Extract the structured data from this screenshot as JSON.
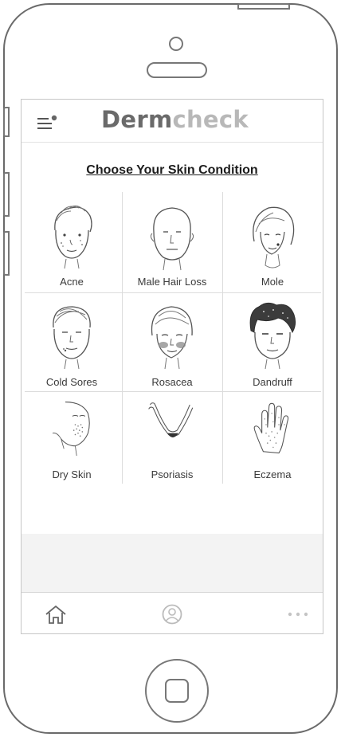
{
  "app": {
    "brand_part1": "Derm",
    "brand_part2": "check"
  },
  "page": {
    "title": "Choose Your Skin Condition"
  },
  "conditions": [
    {
      "label": "Acne",
      "icon": "face-acne-icon"
    },
    {
      "label": "Male Hair Loss",
      "icon": "bald-man-icon"
    },
    {
      "label": "Mole",
      "icon": "woman-mole-icon"
    },
    {
      "label": "Cold Sores",
      "icon": "face-cold-sores-icon"
    },
    {
      "label": "Rosacea",
      "icon": "face-rosacea-icon"
    },
    {
      "label": "Dandruff",
      "icon": "dark-hair-icon"
    },
    {
      "label": "Dry Skin",
      "icon": "dry-skin-face-icon"
    },
    {
      "label": "Psoriasis",
      "icon": "arm-psoriasis-icon"
    },
    {
      "label": "Eczema",
      "icon": "hand-eczema-icon"
    }
  ],
  "tabbar": {
    "items": [
      "home-icon",
      "profile-icon",
      "more-icon"
    ]
  },
  "colors": {
    "line": "#dcdcdc",
    "text": "#3a3a3a",
    "brand_dark": "#6a6a6a",
    "brand_light": "#b8b8b8"
  }
}
